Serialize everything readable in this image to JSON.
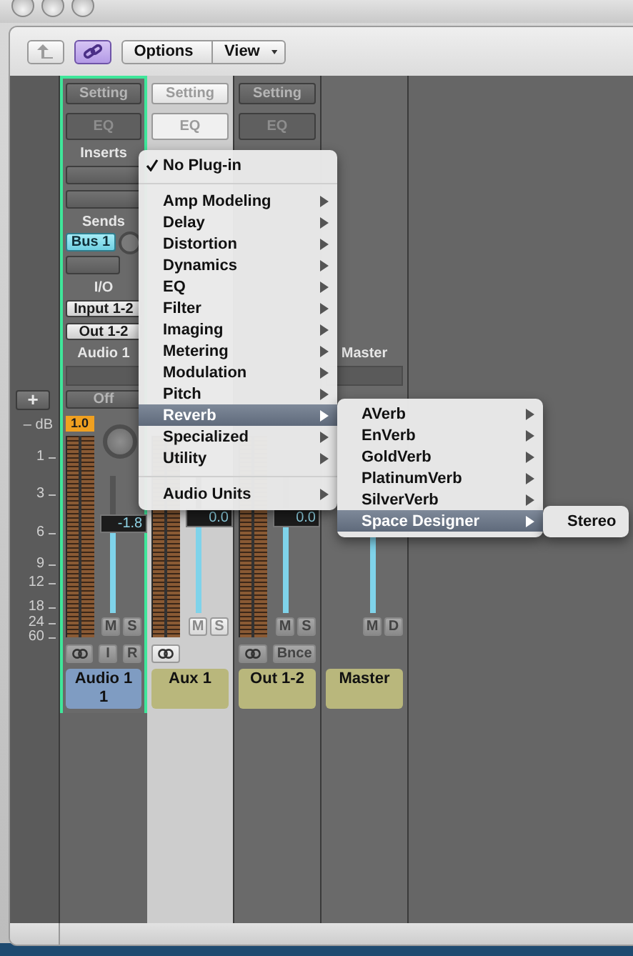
{
  "toolbar": {
    "link_on": true,
    "menus": [
      {
        "label": "Options"
      },
      {
        "label": "View"
      }
    ]
  },
  "scale": {
    "add": "+",
    "unit": "– dB",
    "marks": [
      "1",
      "3",
      "6",
      "9",
      "12",
      "18",
      "24",
      "60"
    ]
  },
  "strips": [
    {
      "selected": true,
      "focused": false,
      "setting": "Setting",
      "eq": "EQ",
      "inserts_label": "Inserts",
      "sends_label": "Sends",
      "send": "Bus 1",
      "io_label": "I/O",
      "input": "Input 1-2",
      "output": "Out 1-2",
      "track_label": "Audio 1",
      "automation": "Off",
      "peak": "1.0",
      "meter": true,
      "pan_knob": true,
      "level": 0.58,
      "fader_value": "-1.8",
      "buttons": [
        "M",
        "S"
      ],
      "bottom_buttons": [
        {
          "kind": "link"
        },
        {
          "kind": "text",
          "label": "I"
        },
        {
          "kind": "text",
          "label": "R"
        }
      ],
      "plate": "Audio 1",
      "plate_number": "1",
      "color": "#7f9cc2"
    },
    {
      "selected": false,
      "focused": true,
      "setting": "Setting",
      "eq": "EQ",
      "meter": true,
      "level": 0.62,
      "fader_value": "0.0",
      "buttons": [
        "M",
        "S"
      ],
      "bottom_buttons": [
        {
          "kind": "link"
        }
      ],
      "plate": "Aux 1",
      "color": "#b9b77c"
    },
    {
      "selected": false,
      "focused": false,
      "setting": "Setting",
      "eq": "EQ",
      "meter": true,
      "level": 0.62,
      "fader_value": "0.0",
      "buttons": [
        "M",
        "S"
      ],
      "bottom_buttons": [
        {
          "kind": "link"
        },
        {
          "kind": "text",
          "label": "Bnce"
        }
      ],
      "plate": "Out 1-2",
      "color": "#b9b77c"
    },
    {
      "selected": false,
      "focused": false,
      "track_label": "Master",
      "meter": false,
      "level": 0.55,
      "buttons": [
        "M",
        "D"
      ],
      "plate": "Master",
      "color": "#b9b77c"
    }
  ],
  "menu": {
    "sections": [
      [
        {
          "label": "No Plug-in",
          "checked": true,
          "submenu": false,
          "selected": false
        }
      ],
      [
        {
          "label": "Amp Modeling",
          "checked": false,
          "submenu": true,
          "selected": false
        },
        {
          "label": "Delay",
          "checked": false,
          "submenu": true,
          "selected": false
        },
        {
          "label": "Distortion",
          "checked": false,
          "submenu": true,
          "selected": false
        },
        {
          "label": "Dynamics",
          "checked": false,
          "submenu": true,
          "selected": false
        },
        {
          "label": "EQ",
          "checked": false,
          "submenu": true,
          "selected": false
        },
        {
          "label": "Filter",
          "checked": false,
          "submenu": true,
          "selected": false
        },
        {
          "label": "Imaging",
          "checked": false,
          "submenu": true,
          "selected": false
        },
        {
          "label": "Metering",
          "checked": false,
          "submenu": true,
          "selected": false
        },
        {
          "label": "Modulation",
          "checked": false,
          "submenu": true,
          "selected": false
        },
        {
          "label": "Pitch",
          "checked": false,
          "submenu": true,
          "selected": false
        },
        {
          "label": "Reverb",
          "checked": false,
          "submenu": true,
          "selected": true
        },
        {
          "label": "Specialized",
          "checked": false,
          "submenu": true,
          "selected": false
        },
        {
          "label": "Utility",
          "checked": false,
          "submenu": true,
          "selected": false
        }
      ],
      [
        {
          "label": "Audio Units",
          "checked": false,
          "submenu": true,
          "selected": false
        }
      ]
    ]
  },
  "submenu": {
    "sections": [
      [
        {
          "label": "AVerb",
          "checked": false,
          "submenu": true,
          "selected": false
        },
        {
          "label": "EnVerb",
          "checked": false,
          "submenu": true,
          "selected": false
        },
        {
          "label": "GoldVerb",
          "checked": false,
          "submenu": true,
          "selected": false
        },
        {
          "label": "PlatinumVerb",
          "checked": false,
          "submenu": true,
          "selected": false
        },
        {
          "label": "SilverVerb",
          "checked": false,
          "submenu": true,
          "selected": false
        },
        {
          "label": "Space Designer",
          "checked": false,
          "submenu": true,
          "selected": true
        }
      ]
    ]
  },
  "submenu2": {
    "sections": [
      [
        {
          "label": "Stereo",
          "checked": false,
          "selected": false
        }
      ]
    ]
  }
}
